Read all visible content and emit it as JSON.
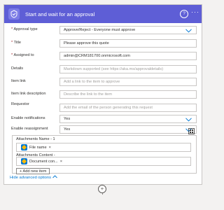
{
  "header": {
    "title": "Start and wait for an approval",
    "help": "?",
    "more": "···",
    "icon": "approval-icon",
    "accent": "#5e5ed6"
  },
  "fields": {
    "approval_type": {
      "label": "Approval type",
      "required": "*",
      "value": "Approve/Reject - Everyone must approve"
    },
    "title": {
      "label": "Title",
      "required": "*",
      "value": "Please approve this quote"
    },
    "assigned_to": {
      "label": "Assigned to",
      "required": "*",
      "value": "admin@CRM181700.onmicrosoft.com"
    },
    "details": {
      "label": "Details",
      "placeholder": "Markdown supported (see https://aka.ms/approvaldetails)"
    },
    "item_link": {
      "label": "Item link",
      "placeholder": "Add a link to the item to approve"
    },
    "item_link_description": {
      "label": "Item link description",
      "placeholder": "Describe the link to the item"
    },
    "requestor": {
      "label": "Requestor",
      "placeholder": "Add the email of the person generating this request"
    },
    "enable_notifications": {
      "label": "Enable notifications",
      "value": "Yes"
    },
    "enable_reassignment": {
      "label": "Enable reassignment",
      "value": "Yes"
    }
  },
  "attachments": {
    "name_label": "Attachments Name - 1",
    "name_token": "File name",
    "content_label": "Attachments Content -",
    "content_label_2": "1",
    "content_token": "Document con...",
    "remove": "×",
    "add_label": "Add new item",
    "add_symbol": "+"
  },
  "footer": {
    "hide_advanced": "Hide advanced options"
  },
  "add_step": "+"
}
